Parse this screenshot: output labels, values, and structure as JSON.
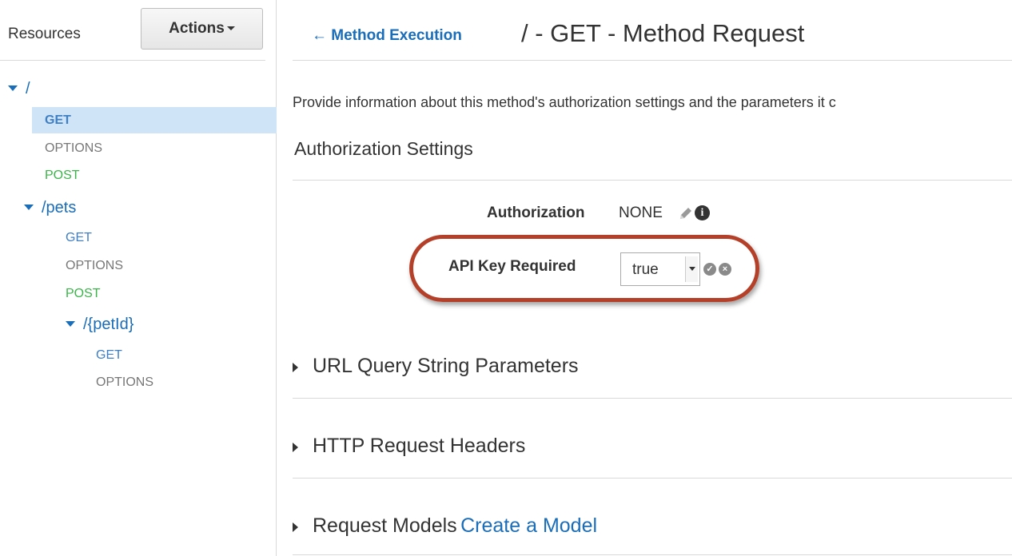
{
  "sidebar": {
    "title": "Resources",
    "actions_label": "Actions",
    "tree": {
      "root": {
        "path": "/",
        "methods": [
          "GET",
          "OPTIONS",
          "POST"
        ]
      },
      "pets": {
        "path": "/pets",
        "methods": [
          "GET",
          "OPTIONS",
          "POST"
        ]
      },
      "petid": {
        "path": "/{petId}",
        "methods": [
          "GET",
          "OPTIONS"
        ]
      }
    },
    "selected": "GET"
  },
  "header": {
    "back_link": "← Method Execution",
    "title": "/ - GET - Method Request"
  },
  "main": {
    "description": "Provide information about this method's authorization settings and the parameters it c",
    "auth_section_title": "Authorization Settings",
    "authorization": {
      "label": "Authorization",
      "value": "NONE"
    },
    "api_key": {
      "label": "API Key Required",
      "selected": "true"
    },
    "sections": {
      "query": "URL Query String Parameters",
      "headers": "HTTP Request Headers",
      "models": "Request Models",
      "create_model": "Create a Model"
    }
  },
  "colors": {
    "link": "#1a6db8",
    "get": "#3f7fc4",
    "post": "#3bb54a",
    "options": "#777777",
    "selected_row": "#cfe4f7",
    "highlight_oval": "#b5402a"
  }
}
